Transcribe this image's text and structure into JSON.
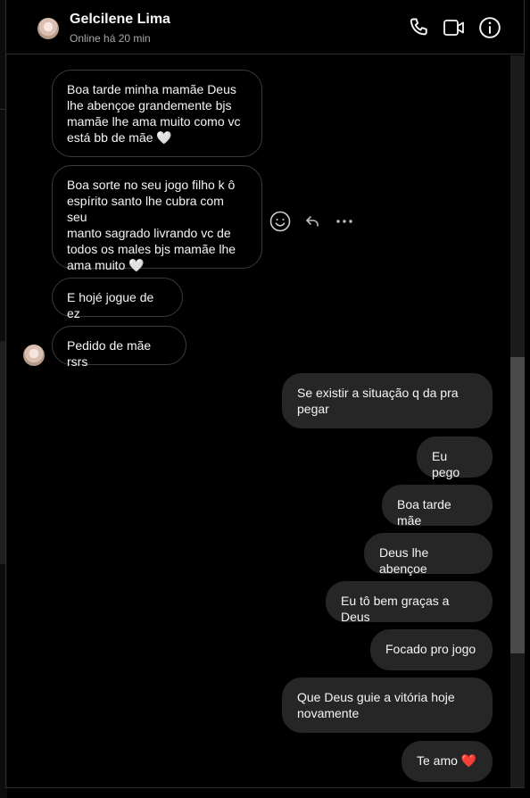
{
  "contact": {
    "name": "Gelcilene Lima",
    "status": "Online há 20 min"
  },
  "header_icons": [
    "phone-icon",
    "video-camera-icon",
    "info-icon"
  ],
  "message_actions": [
    "smiley-react-icon",
    "reply-icon",
    "more-options-icon"
  ],
  "messages_incoming": [
    "Boa tarde minha mamãe Deus\nlhe abençoe grandemente bjs\nmamãe lhe ama muito como vc\nestá bb de mãe 🤍",
    "Boa sorte no seu jogo filho k ô\nespírito santo lhe cubra com seu\nmanto sagrado livrando vc de\ntodos os males bjs mamãe lhe\nama muito 🤍",
    "E hojé jogue de ez",
    "Pedido de mãe rsrs"
  ],
  "messages_outgoing": [
    "Se existir a situação q da pra\npegar",
    "Eu pego",
    "Boa tarde mãe",
    "Deus lhe abençoe",
    "Eu tô bem graças a Deus",
    "Focado pro jogo",
    "Que Deus guie a vitória hoje\nnovamente",
    "Te amo ❤️"
  ],
  "colors": {
    "background": "#000000",
    "outgoing_bubble": "#262626",
    "incoming_border": "#3a3a3a",
    "secondary_text": "#a8a8a8",
    "heart": "#e0245e"
  }
}
